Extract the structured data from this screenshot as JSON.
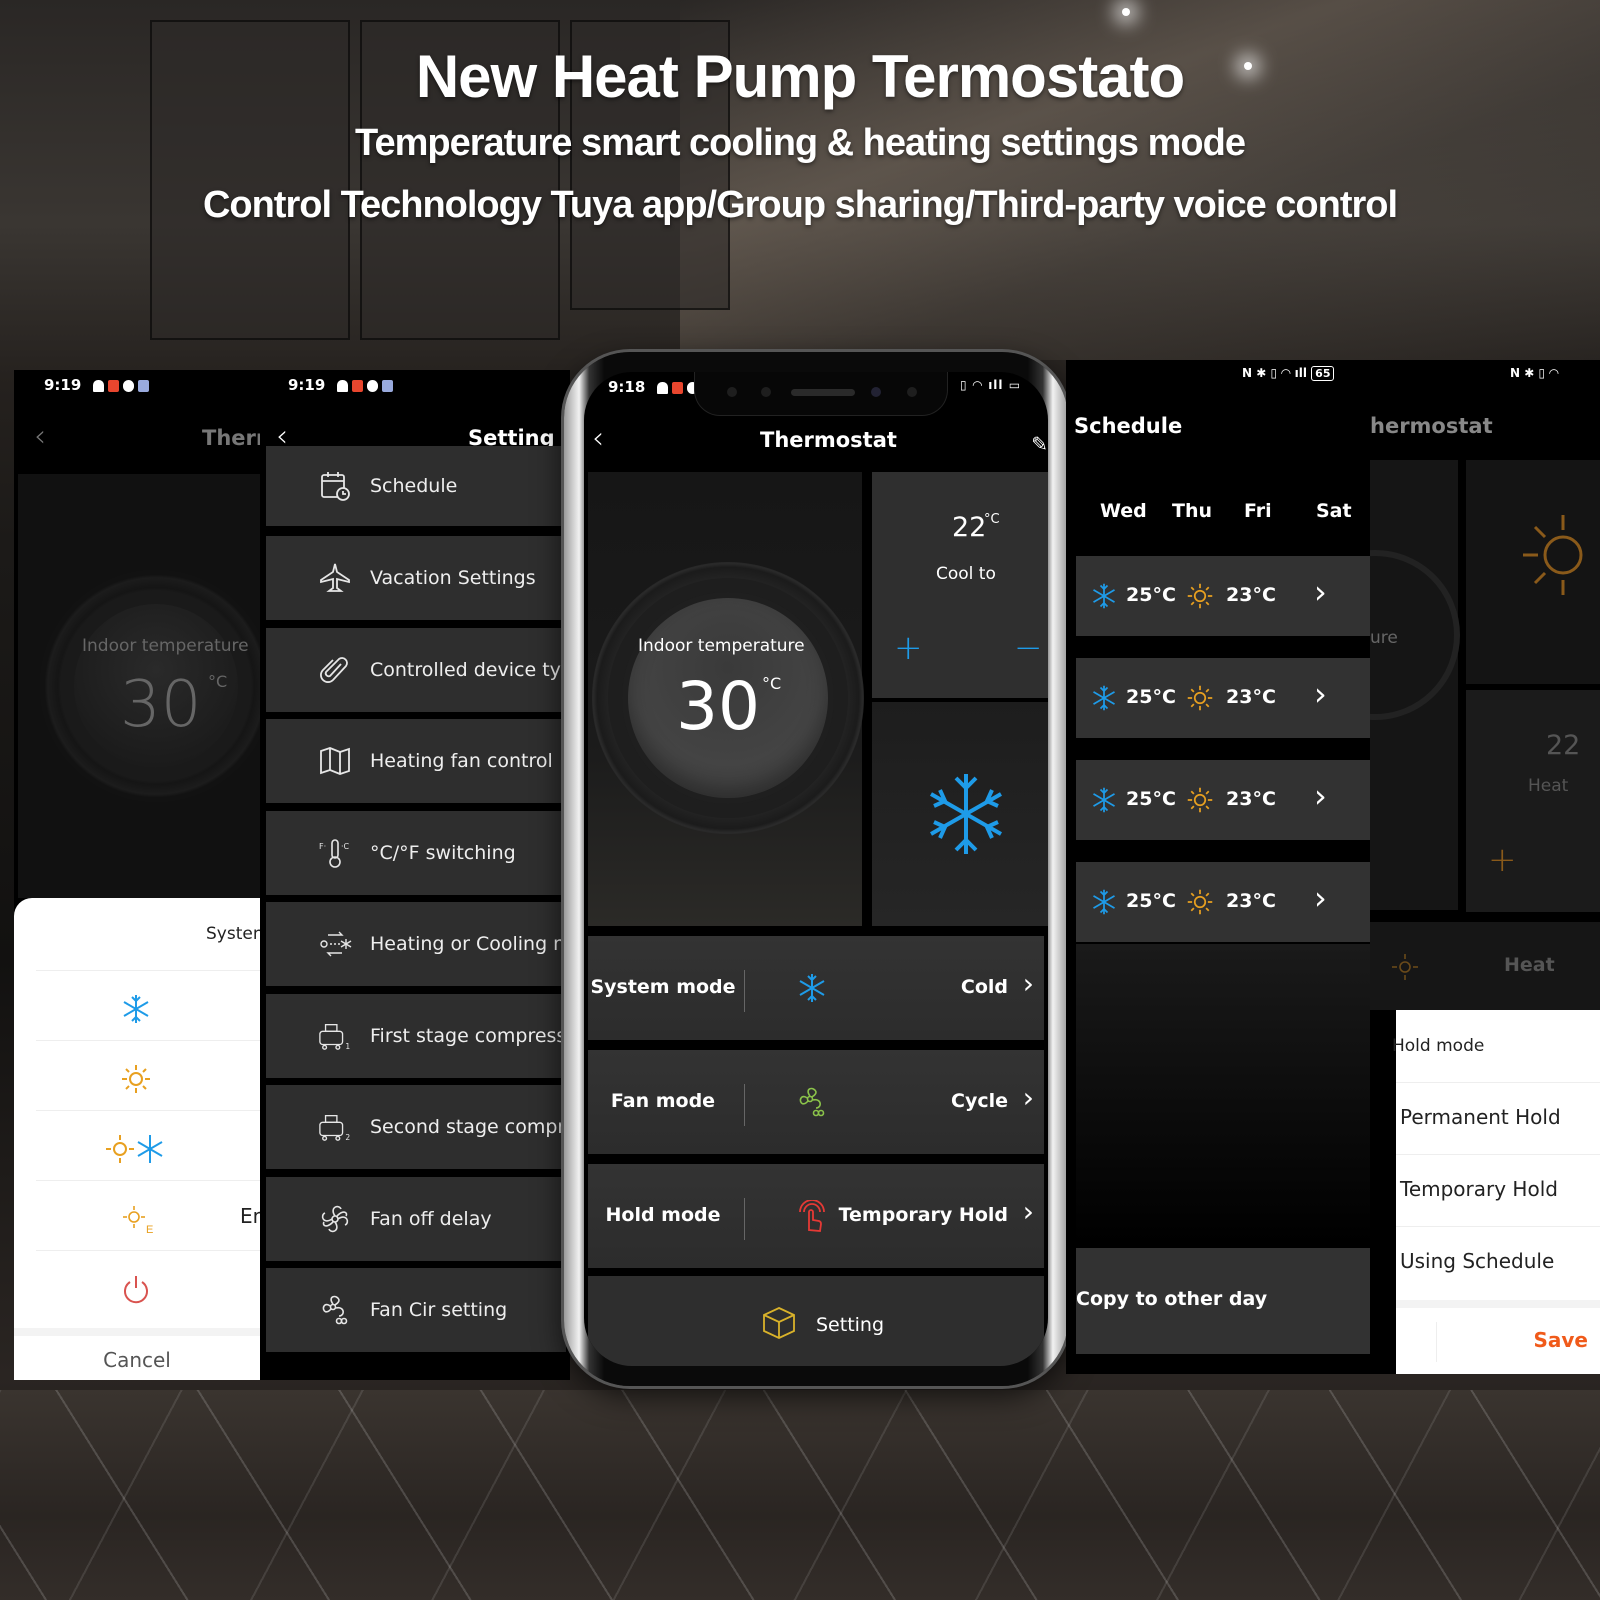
{
  "banner": {
    "title": "New Heat Pump Termostato",
    "subtitle": "Temperature smart cooling & heating settings mode",
    "tagline": "Control Technology Tuya app/Group sharing/Third-party voice control"
  },
  "colors": {
    "cool_blue": "#1e9be8",
    "heat_orange": "#e8a020",
    "power_red": "#d9534f",
    "fan_green": "#8bc34a",
    "hold_red": "#e53935",
    "save_orange": "#f05a1a"
  },
  "screen_system_mode": {
    "status_time": "9:19",
    "nav_title": "Therr",
    "indoor_label": "Indoor temperature",
    "indoor_value": "30",
    "unit": "°C",
    "sheet_title": "Systen",
    "options": [
      {
        "icon": "snowflake-icon",
        "label": ""
      },
      {
        "icon": "sun-icon",
        "label": ""
      },
      {
        "icon": "sun-snowflake-icon",
        "label": ""
      },
      {
        "icon": "emergency-heat-icon",
        "label": "Eme"
      },
      {
        "icon": "power-icon",
        "label": ""
      }
    ],
    "cancel_label": "Cancel"
  },
  "screen_setting": {
    "status_time": "9:19",
    "nav_title": "Setting",
    "items": [
      {
        "icon": "calendar-clock-icon",
        "label": "Schedule"
      },
      {
        "icon": "airplane-icon",
        "label": "Vacation Settings"
      },
      {
        "icon": "paperclip-icon",
        "label": "Controlled device type"
      },
      {
        "icon": "map-icon",
        "label": "Heating fan control"
      },
      {
        "icon": "thermometer-cf-icon",
        "label": "°C/°F switching"
      },
      {
        "icon": "heat-cool-switch-icon",
        "label": "Heating or Cooling mo"
      },
      {
        "icon": "compressor-1-icon",
        "label": "First stage compressor"
      },
      {
        "icon": "compressor-2-icon",
        "label": "Second stage compres"
      },
      {
        "icon": "fan-icon",
        "label": "Fan off delay"
      },
      {
        "icon": "fan-circulate-icon",
        "label": "Fan Cir setting"
      }
    ]
  },
  "screen_main": {
    "status_time": "9:18",
    "nav_title": "Thermostat",
    "indoor_label": "Indoor temperature",
    "indoor_value": "30",
    "unit": "°C",
    "setpoint_value": "22",
    "setpoint_unit": "°C",
    "setpoint_label": "Cool to",
    "plus_label": "+",
    "minus_label": "−",
    "modes": [
      {
        "label": "System mode",
        "icon": "snowflake-icon",
        "value": "Cold"
      },
      {
        "label": "Fan mode",
        "icon": "fan-circulate-icon",
        "value": "Cycle"
      },
      {
        "label": "Hold mode",
        "icon": "touch-hold-icon",
        "value": "Temporary Hold"
      }
    ],
    "setting_label": "Setting"
  },
  "screen_schedule": {
    "battery": "65",
    "nav_title": "Schedule",
    "days": [
      "Wed",
      "Thu",
      "Fri",
      "Sat"
    ],
    "rows": [
      {
        "cool": "25°C",
        "heat": "23°C"
      },
      {
        "cool": "25°C",
        "heat": "23°C"
      },
      {
        "cool": "25°C",
        "heat": "23°C"
      },
      {
        "cool": "25°C",
        "heat": "23°C"
      }
    ],
    "copy_label": "Copy to other day"
  },
  "screen_hold": {
    "nav_title": "hermostat",
    "indoor_partial": "ure",
    "setpoint_partial": "22",
    "setpoint_label_partial": "Heat",
    "mode_label": "Heat",
    "sheet_title": "Hold mode",
    "options": [
      "Permanent Hold",
      "Temporary Hold",
      "Using Schedule"
    ],
    "save_label": "Save"
  }
}
